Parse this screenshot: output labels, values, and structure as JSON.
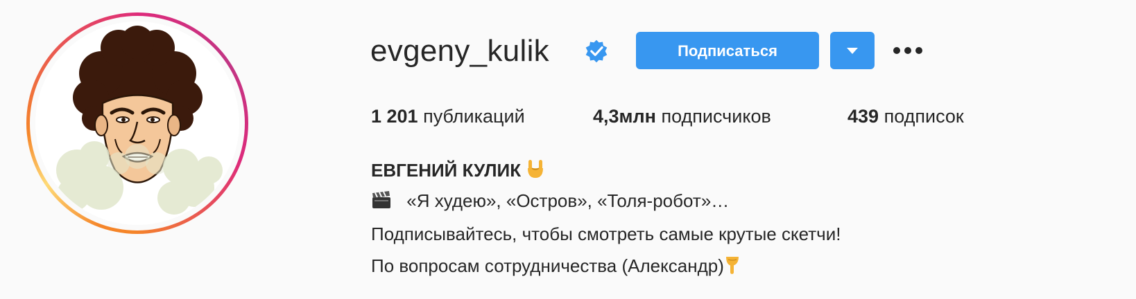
{
  "profile": {
    "username": "evgeny_kulik",
    "verified": true,
    "follow_button": "Подписаться",
    "more_menu": "more-options"
  },
  "stats": {
    "posts_count": "1 201",
    "posts_label": "публикаций",
    "followers_count": "4,3млн",
    "followers_label": "подписчиков",
    "following_count": "439",
    "following_label": "подписок"
  },
  "bio": {
    "name": "ЕВГЕНИЙ КУЛИК",
    "name_emoji": "rock-on-hand-icon",
    "line1": "«Я худею», «Остров», «Толя-робот»…",
    "line1_emoji": "clapperboard-icon",
    "line2": "Подписывайтесь, чтобы смотреть самые крутые скетчи!",
    "line3": "По вопросам сотрудничества (Александр)",
    "line3_emoji": "pointing-down-icon"
  },
  "colors": {
    "accent": "#3897f0",
    "text": "#262626",
    "background": "#fafafa",
    "ring_start": "#f58529",
    "ring_end": "#dd2a7b"
  }
}
